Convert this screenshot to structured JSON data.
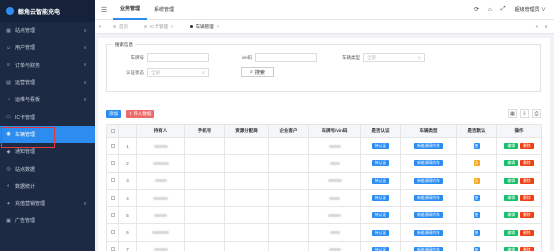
{
  "app": {
    "title": "鲸角云智能充电"
  },
  "sidebar": {
    "items": [
      {
        "label": "站点管理",
        "icon": "grid-icon",
        "chevron": "∨",
        "active": false
      },
      {
        "label": "用户管理",
        "icon": "user-icon",
        "chevron": "∨",
        "active": false
      },
      {
        "label": "订单与财务",
        "icon": "list-icon",
        "chevron": "∨",
        "active": false
      },
      {
        "label": "运营管理",
        "icon": "chart-icon",
        "chevron": "∨",
        "active": false
      },
      {
        "label": "运维与看板",
        "icon": "dashboard-icon",
        "chevron": "∨",
        "active": false
      },
      {
        "label": "IC卡管理",
        "icon": "card-icon",
        "chevron": "",
        "active": false
      },
      {
        "label": "车辆管理",
        "icon": "car-icon",
        "chevron": "",
        "active": true
      },
      {
        "label": "通知管理",
        "icon": "bell-icon",
        "chevron": "",
        "active": false
      },
      {
        "label": "站点数据",
        "icon": "pin-icon",
        "chevron": "",
        "active": false
      },
      {
        "label": "数据统计",
        "icon": "stats-icon",
        "chevron": "",
        "active": false
      },
      {
        "label": "充值营销管理",
        "icon": "gift-icon",
        "chevron": "∨",
        "active": false
      },
      {
        "label": "广告管理",
        "icon": "ad-icon",
        "chevron": "",
        "active": false
      }
    ]
  },
  "topbar": {
    "nav": [
      {
        "label": "业务管理",
        "active": true
      },
      {
        "label": "系统管理",
        "active": false
      }
    ],
    "user": "超级管理员 ∨"
  },
  "tabs": {
    "items": [
      {
        "label": "首页",
        "current": false,
        "closable": false
      },
      {
        "label": "IC卡管理",
        "current": false,
        "closable": true
      },
      {
        "label": "车辆管理",
        "current": true,
        "closable": true
      }
    ]
  },
  "search": {
    "legend": "搜索信息",
    "fields": [
      {
        "label": "车牌号",
        "placeholder": ""
      },
      {
        "label": "vin码",
        "placeholder": ""
      },
      {
        "label": "车辆类型",
        "value": "全部"
      },
      {
        "label": "认证状态",
        "value": "全部"
      }
    ],
    "button": "搜索"
  },
  "toolbar": {
    "add": "添加",
    "import": "导入数据"
  },
  "table": {
    "columns": [
      "",
      "持有人",
      "手机号",
      "资源分配商",
      "企业客户",
      "车牌号/vin码",
      "是否认证",
      "车辆类型",
      "是否默认",
      "操作"
    ],
    "auth_tag": "待认证",
    "type_tag": "新能源网约车",
    "default_yes": "是",
    "default_no": "否",
    "edit_label": "编辑",
    "delete_label": "删除",
    "rows": [
      {
        "index": "1",
        "default": "yes"
      },
      {
        "index": "2",
        "default": "no"
      },
      {
        "index": "3",
        "default": "no"
      },
      {
        "index": "4",
        "default": "yes"
      },
      {
        "index": "5",
        "default": "yes"
      },
      {
        "index": "6",
        "default": "yes"
      },
      {
        "index": "7",
        "default": "yes"
      }
    ]
  },
  "colors": {
    "sidebar": "#1c2a43",
    "accent": "#2d8cf0",
    "danger": "#ed4014",
    "success": "#19be6b"
  }
}
